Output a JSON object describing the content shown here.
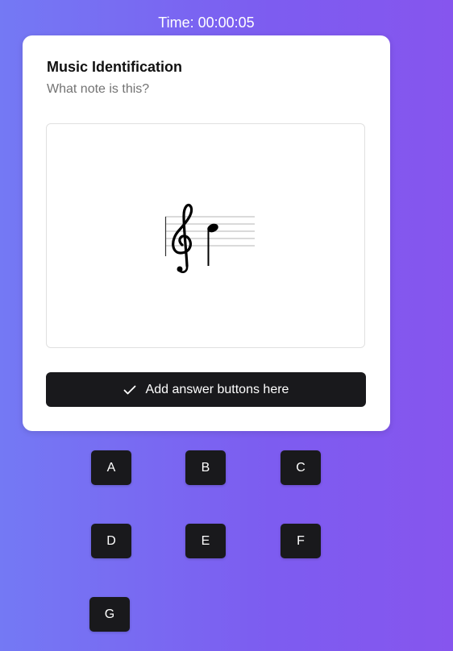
{
  "timer": {
    "text": "Time: 00:00:05"
  },
  "card": {
    "title": "Music Identification",
    "subtitle": "What note is this?"
  },
  "primary_button": {
    "label": "Add answer buttons here",
    "icon": "check-icon"
  },
  "answers": [
    "A",
    "B",
    "C",
    "D",
    "E",
    "F",
    "G"
  ],
  "colors": {
    "background_start": "#7479f4",
    "background_end": "#8655ee",
    "card": "#ffffff",
    "button": "#19191c"
  }
}
